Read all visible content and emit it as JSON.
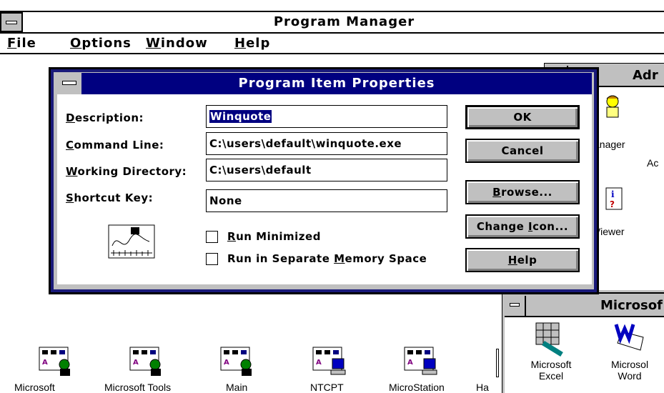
{
  "program_manager": {
    "title": "Program Manager",
    "menu": [
      "File",
      "Options",
      "Window",
      "Help"
    ]
  },
  "background_windows": {
    "admin": {
      "title_fragment": "Adr",
      "items": [
        "anager",
        "Ac",
        "Viewer"
      ]
    },
    "microsoft": {
      "title_fragment": "Microsof",
      "items": [
        {
          "line1": "Microsoft",
          "line2": "Excel"
        },
        {
          "line1": "Microsol",
          "line2": "Word"
        }
      ]
    }
  },
  "dialog": {
    "title": "Program Item Properties",
    "labels": {
      "description": "Description:",
      "command_line": "Command Line:",
      "working_directory": "Working Directory:",
      "shortcut_key": "Shortcut Key:"
    },
    "fields": {
      "description": "Winquote",
      "command_line": "C:\\users\\default\\winquote.exe",
      "working_directory": "C:\\users\\default",
      "shortcut_key": "None"
    },
    "checkboxes": {
      "run_minimized": {
        "label": "Run Minimized",
        "checked": false
      },
      "separate_memory": {
        "label": "Run in Separate Memory Space",
        "checked": false
      }
    },
    "buttons": {
      "ok": "OK",
      "cancel": "Cancel",
      "browse": "Browse...",
      "change_icon": "Change Icon...",
      "help": "Help"
    }
  },
  "group_icons": [
    "Microsoft",
    "Microsoft Tools",
    "Main",
    "NTCPT",
    "MicroStation",
    "Ha"
  ],
  "colors": {
    "dialog_title": "#000080",
    "dialog_frame": "#1a1a7a",
    "button_face": "#c0c0c0",
    "selection": "#000080"
  }
}
